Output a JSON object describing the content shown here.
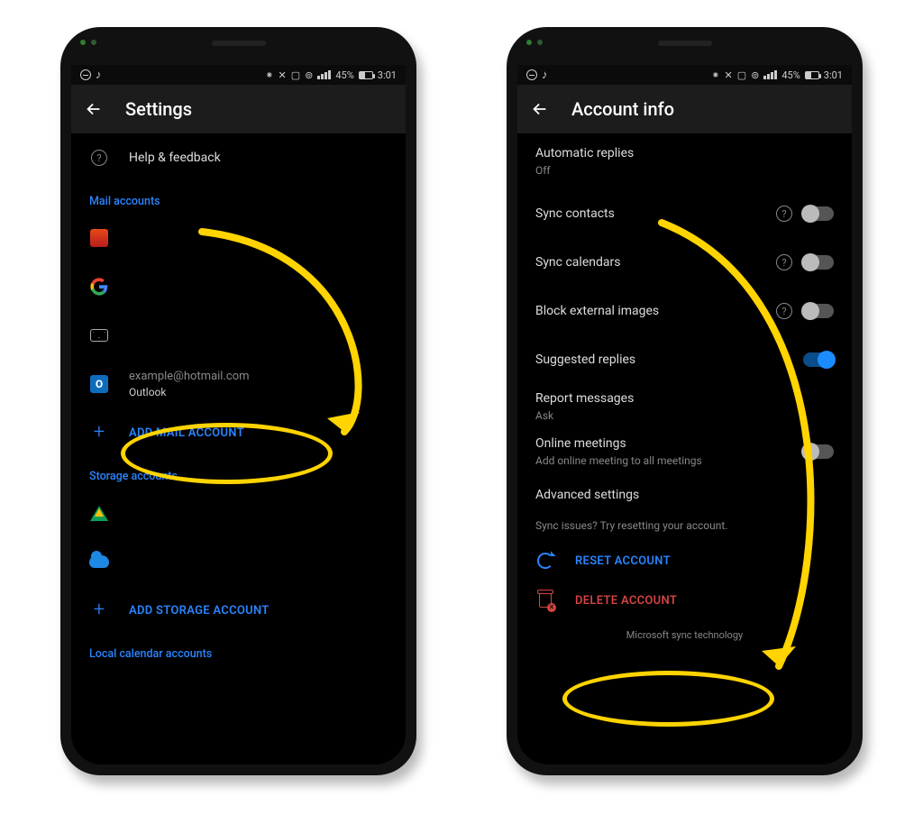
{
  "status": {
    "battery": "45%",
    "time": "3:01"
  },
  "left": {
    "title": "Settings",
    "help": "Help & feedback",
    "section_mail": "Mail accounts",
    "account_email": "example@hotmail.com",
    "account_provider": "Outlook",
    "add_mail": "ADD MAIL ACCOUNT",
    "section_storage": "Storage accounts",
    "add_storage": "ADD STORAGE ACCOUNT",
    "section_calendar": "Local calendar accounts"
  },
  "right": {
    "title": "Account info",
    "auto_replies": "Automatic replies",
    "auto_replies_val": "Off",
    "sync_contacts": "Sync contacts",
    "sync_calendars": "Sync calendars",
    "block_images": "Block external images",
    "suggested": "Suggested replies",
    "report": "Report messages",
    "report_val": "Ask",
    "online": "Online meetings",
    "online_sub": "Add online meeting to all meetings",
    "advanced": "Advanced settings",
    "sync_hint": "Sync issues? Try resetting your account.",
    "reset": "RESET ACCOUNT",
    "delete": "DELETE ACCOUNT",
    "footer": "Microsoft sync technology"
  }
}
